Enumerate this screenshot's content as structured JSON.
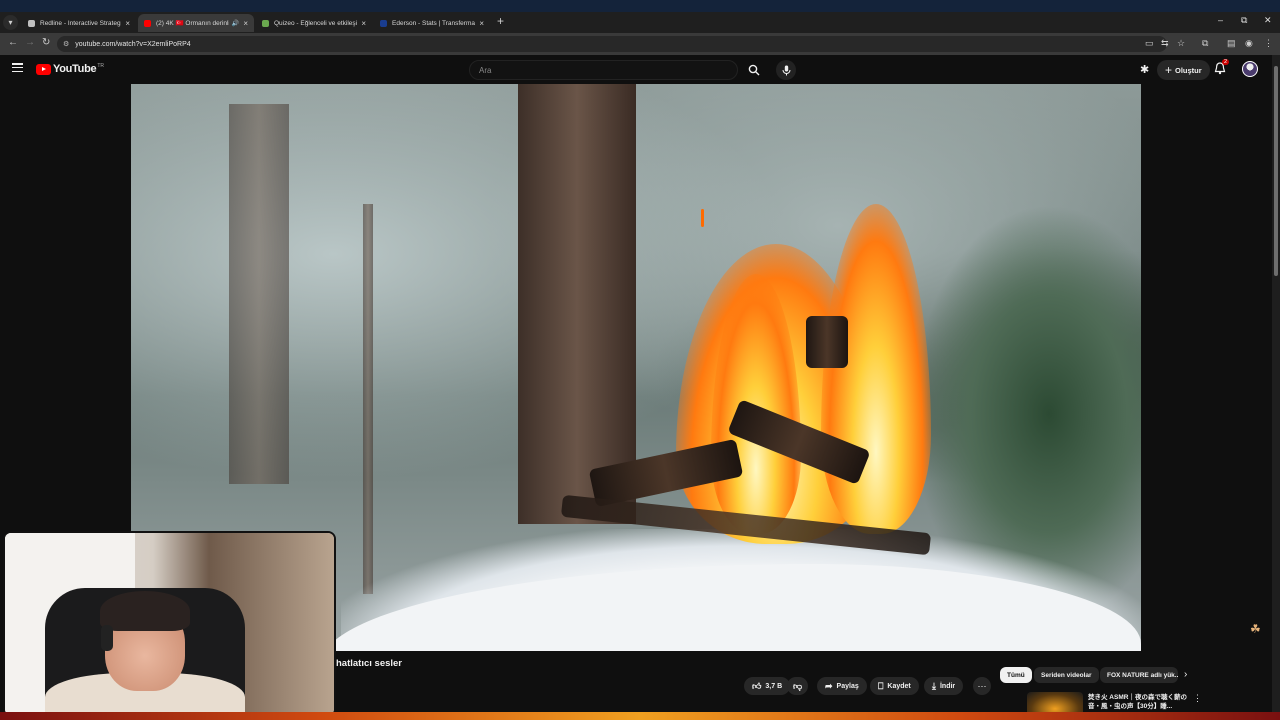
{
  "browser": {
    "tabs": [
      {
        "title": "Redline - Interactive Strategic I...",
        "favicon_color": "#c0c0c0",
        "active": false
      },
      {
        "title": "(2) 4K 🇹🇷 Ormanın derinli...",
        "favicon_color": "#ff0000",
        "active": true
      },
      {
        "title": "Quizeo - Eğlenceli ve etkileşimli ...",
        "favicon_color": "#6aa84f",
        "active": false
      },
      {
        "title": "Ederson - Stats | Transfermarkt",
        "favicon_color": "#1a3d8f",
        "active": false
      }
    ],
    "new_tab": "+",
    "window_controls": {
      "minimize": "–",
      "restore": "⧉",
      "close": "✕"
    },
    "url": "youtube.com/watch?v=X2emliPoRP4"
  },
  "youtube": {
    "logo_text": "YouTube",
    "region": "TR",
    "search_placeholder": "Ara",
    "create_label": "Oluştur",
    "notification_count": "2"
  },
  "video": {
    "title_fragment": "hatlatıcı sesler"
  },
  "actions": {
    "like_count": "3,7 B",
    "share_label": "Paylaş",
    "save_label": "Kaydet",
    "download_label": "İndir"
  },
  "chips": [
    {
      "label": "Tümü",
      "active": true
    },
    {
      "label": "Seriden videolar",
      "active": false
    },
    {
      "label": "FOX NATURE adlı yük...",
      "active": false
    }
  ],
  "recommendation": {
    "title": "焚き火 ASMR｜夜の森で聴く薪の音・風・虫の声【30分】睡..."
  },
  "colors": {
    "accent": "#ff0000",
    "page_bg": "#0f0f0f",
    "chip_bg": "#272727",
    "badge": "#cc0000"
  }
}
